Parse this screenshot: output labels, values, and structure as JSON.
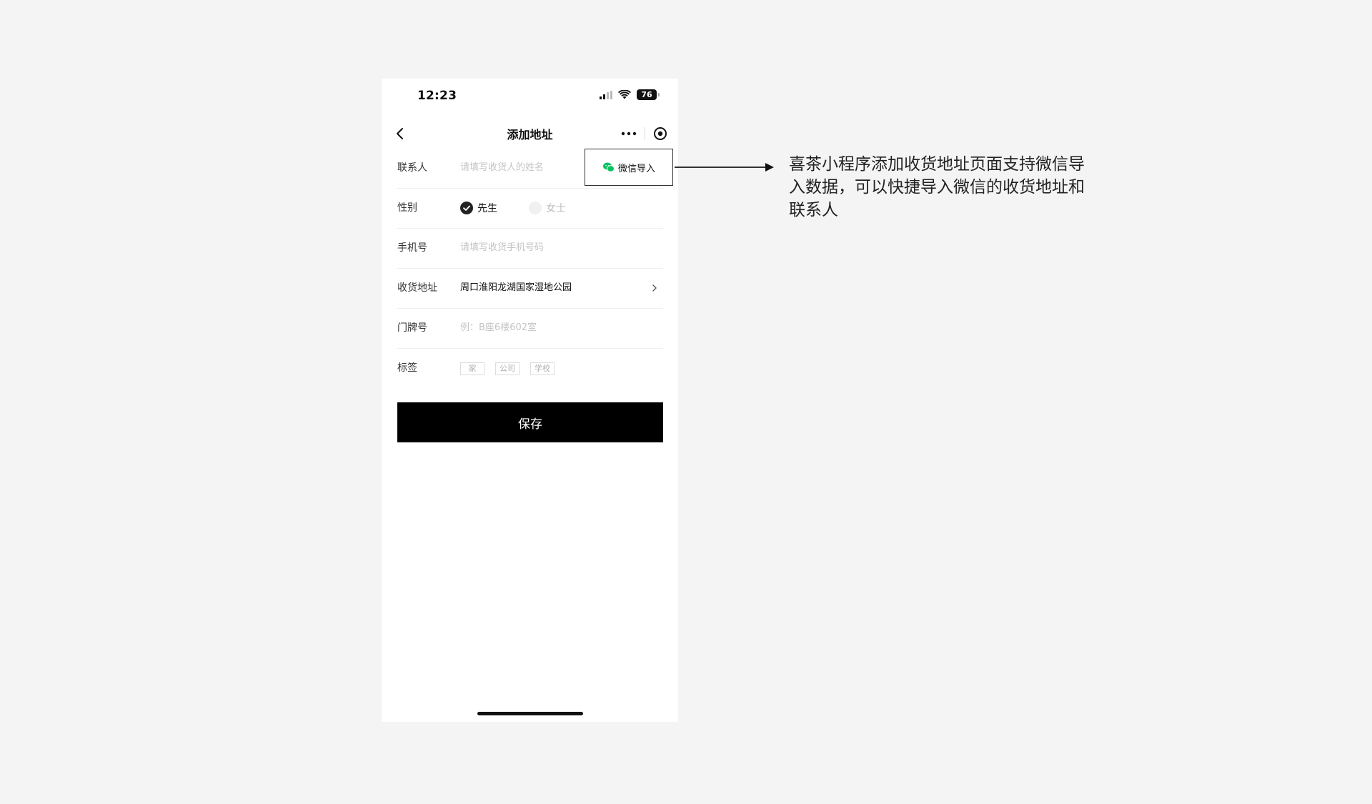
{
  "status_bar": {
    "time": "12:23",
    "battery": "76"
  },
  "nav": {
    "title": "添加地址"
  },
  "form": {
    "contact": {
      "label": "联系人",
      "placeholder": "请填写收货人的姓名"
    },
    "wechat_import": {
      "label": "微信导入",
      "icon_color": "#07c160"
    },
    "gender": {
      "label": "性别",
      "options": [
        {
          "label": "先生",
          "checked": true
        },
        {
          "label": "女士",
          "checked": false
        }
      ]
    },
    "phone": {
      "label": "手机号",
      "placeholder": "请填写收货手机号码"
    },
    "address": {
      "label": "收货地址",
      "value": "周口淮阳龙湖国家湿地公园"
    },
    "door_number": {
      "label": "门牌号",
      "placeholder": "例：B座6楼602室"
    },
    "tags": {
      "label": "标签",
      "options": [
        "家",
        "公司",
        "学校"
      ]
    }
  },
  "save_button": {
    "label": "保存"
  },
  "annotation": {
    "text": "喜茶小程序添加收货地址页面支持微信导入数据，可以快捷导入微信的收货地址和联系人"
  },
  "colors": {
    "background": "#f4f4f4",
    "primary": "#000000",
    "wechat_green": "#07c160"
  }
}
